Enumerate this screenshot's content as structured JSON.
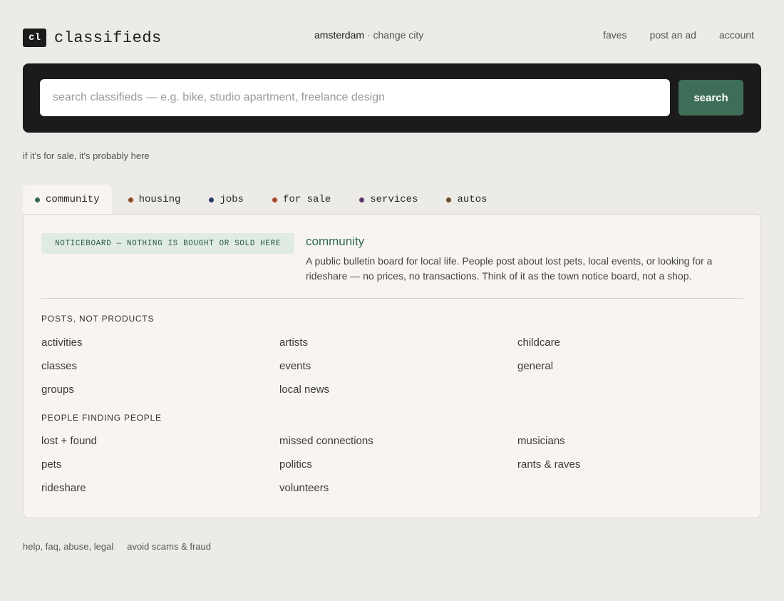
{
  "header": {
    "logo_mark": "cl",
    "logo_text": "classifieds",
    "city_name": "amsterdam",
    "city_separator": "·",
    "change_city": "change city",
    "nav": [
      "faves",
      "post an ad",
      "account"
    ]
  },
  "search": {
    "placeholder": "search classifieds — e.g. bike, studio apartment, freelance design",
    "value": "",
    "button_label": "search"
  },
  "tagline": "if it's for sale, it's probably here",
  "tabs": [
    {
      "label": "community",
      "dot_color": "#2f6a4f",
      "active": true
    },
    {
      "label": "housing",
      "dot_color": "#8a4a2a",
      "active": false
    },
    {
      "label": "jobs",
      "dot_color": "#2a3a6e",
      "active": false
    },
    {
      "label": "for sale",
      "dot_color": "#b0452a",
      "active": false
    },
    {
      "label": "services",
      "dot_color": "#5a3a6e",
      "active": false
    },
    {
      "label": "autos",
      "dot_color": "#6a4a2a",
      "active": false
    }
  ],
  "panel": {
    "badge": "NOTICEBOARD — NOTHING IS BOUGHT OR SOLD HERE",
    "title": "community",
    "description": "A public bulletin board for local life. People post about lost pets, local events, or looking for a rideshare — no prices, no transactions. Think of it as the town notice board, not a shop.",
    "groups": [
      {
        "heading": "POSTS, NOT PRODUCTS",
        "links": [
          "activities",
          "artists",
          "childcare",
          "classes",
          "events",
          "general",
          "groups",
          "local news"
        ]
      },
      {
        "heading": "PEOPLE FINDING PEOPLE",
        "links": [
          "lost + found",
          "missed connections",
          "musicians",
          "pets",
          "politics",
          "rants & raves",
          "rideshare",
          "volunteers"
        ]
      }
    ]
  },
  "footer": [
    "help, faq, abuse, legal",
    "avoid scams & fraud"
  ],
  "colors": {
    "accent_green": "#3f6e58",
    "panel_bg": "#f8f5f1",
    "page_bg": "#edebe7",
    "search_bar_bg": "#1c1b1b"
  }
}
